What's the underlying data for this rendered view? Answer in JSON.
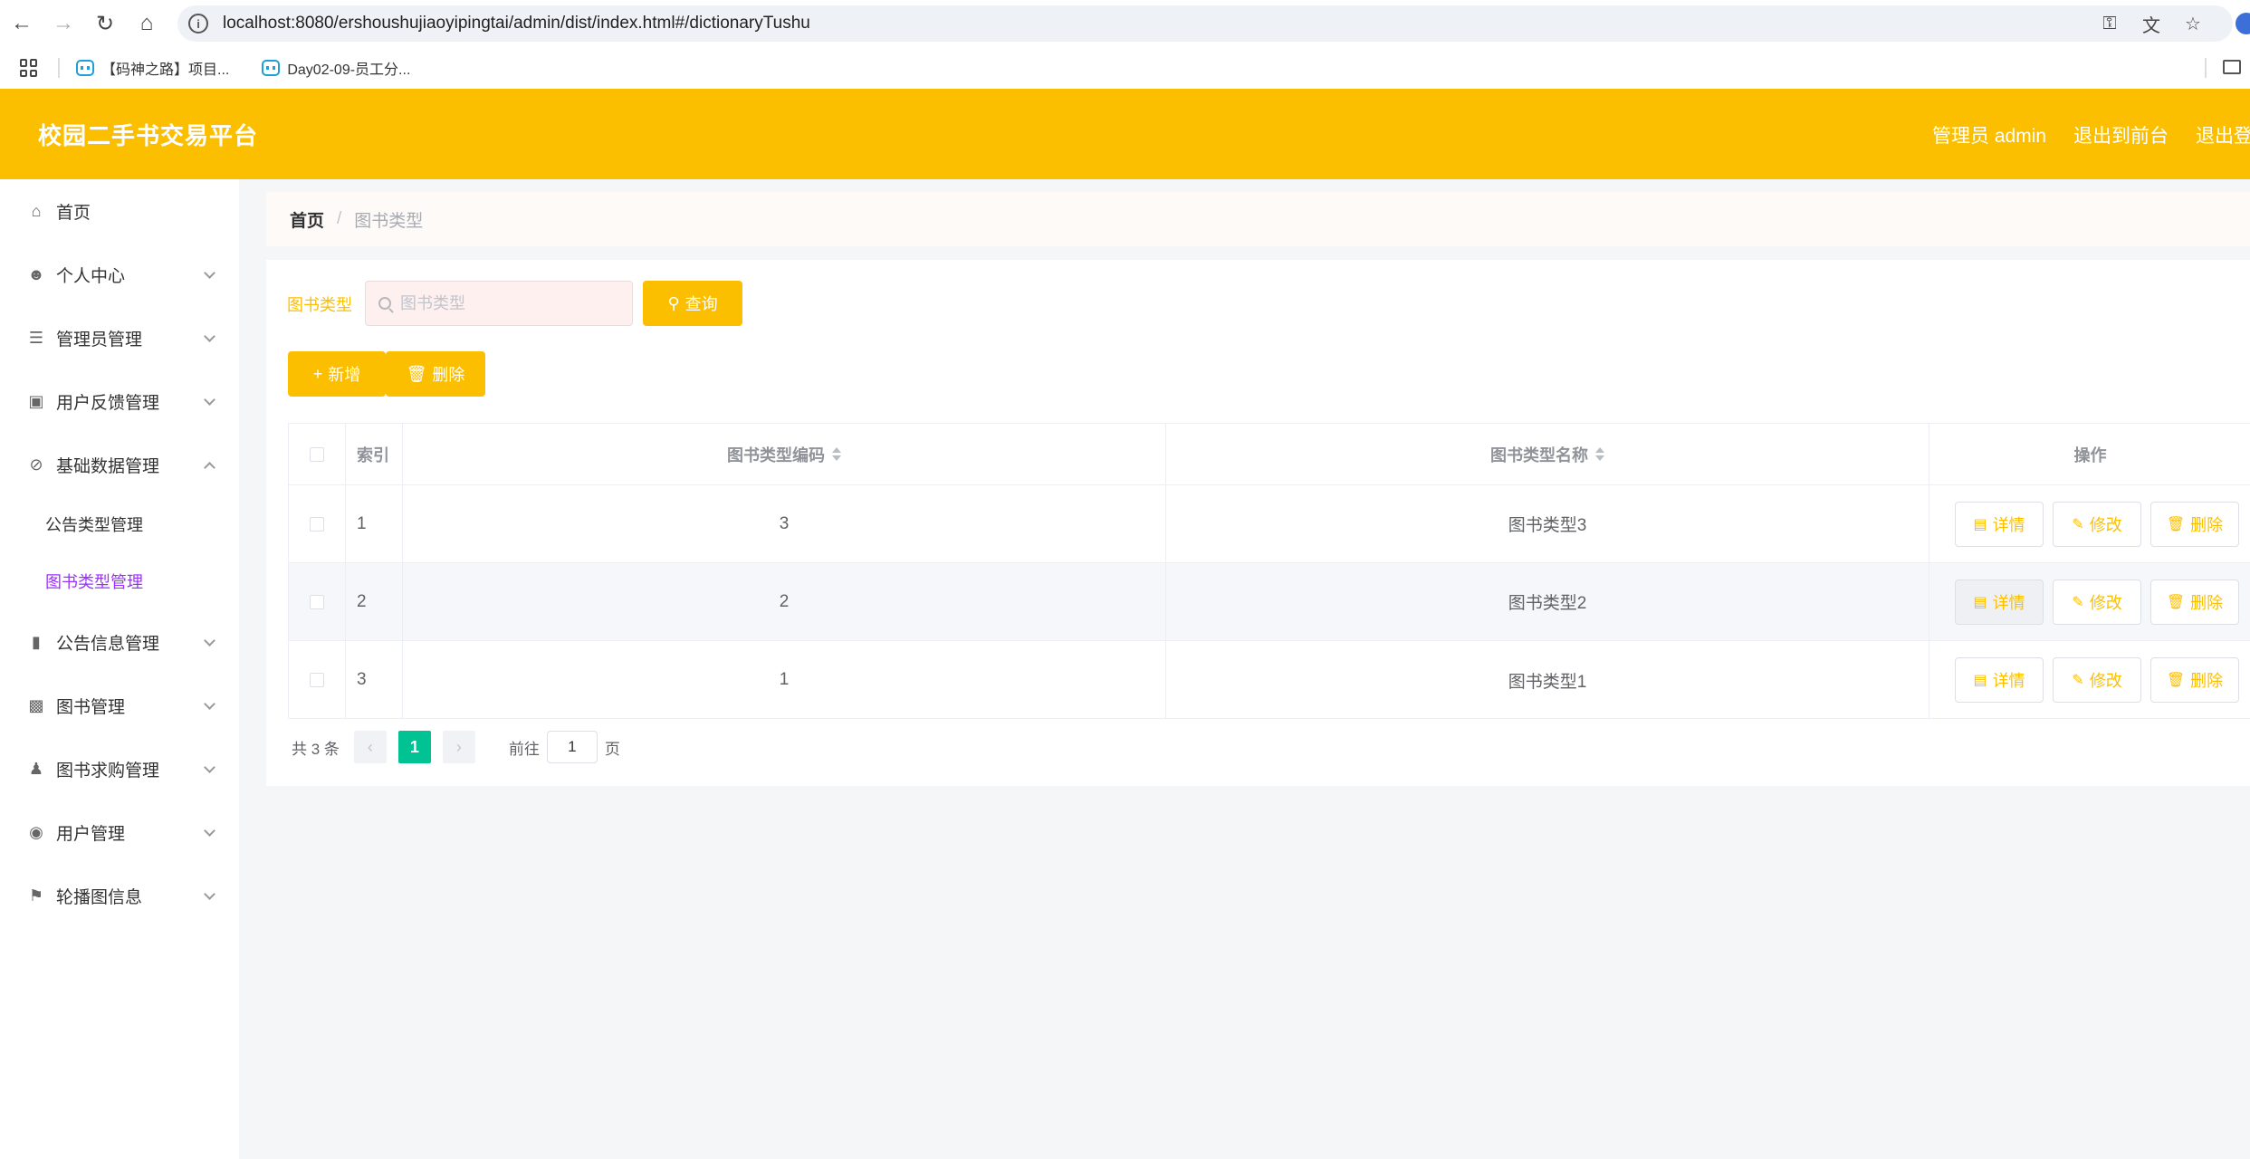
{
  "browser": {
    "url": "localhost:8080/ershoushujiaoyipingtai/admin/dist/index.html#/dictionaryTushu",
    "bookmarks": [
      "【码神之路】项目...",
      "Day02-09-员工分..."
    ]
  },
  "header": {
    "title": "校园二手书交易平台",
    "admin_label": "管理员 admin",
    "to_front_label": "退出到前台",
    "logout_label": "退出登录"
  },
  "sidebar": {
    "items": [
      {
        "label": "首页",
        "icon": "home-icon"
      },
      {
        "label": "个人中心",
        "icon": "user-icon"
      },
      {
        "label": "管理员管理",
        "icon": "sliders-icon"
      },
      {
        "label": "用户反馈管理",
        "icon": "clipboard-icon"
      },
      {
        "label": "基础数据管理",
        "icon": "bell-off-icon"
      },
      {
        "label": "公告信息管理",
        "icon": "ticket-icon"
      },
      {
        "label": "图书管理",
        "icon": "bar-chart-icon"
      },
      {
        "label": "图书求购管理",
        "icon": "stamp-icon"
      },
      {
        "label": "用户管理",
        "icon": "map-pin-icon"
      },
      {
        "label": "轮播图信息",
        "icon": "flag-icon"
      }
    ],
    "submenu": [
      {
        "label": "公告类型管理"
      },
      {
        "label": "图书类型管理"
      }
    ]
  },
  "breadcrumb": {
    "home": "首页",
    "separator": "/",
    "current": "图书类型"
  },
  "search": {
    "label": "图书类型",
    "placeholder": "图书类型",
    "query_label": "查询"
  },
  "actions": {
    "add_label": "新增",
    "delete_label": "删除"
  },
  "table": {
    "headers": [
      "索引",
      "图书类型编码",
      "图书类型名称",
      "操作"
    ],
    "rows": [
      {
        "index": "1",
        "code": "3",
        "name": "图书类型3"
      },
      {
        "index": "2",
        "code": "2",
        "name": "图书类型2"
      },
      {
        "index": "3",
        "code": "1",
        "name": "图书类型1"
      }
    ],
    "row_actions": {
      "detail": "详情",
      "edit": "修改",
      "delete": "删除"
    }
  },
  "pagination": {
    "total_text": "共 3 条",
    "current_page": "1",
    "goto_prefix": "前往",
    "goto_value": "1",
    "goto_suffix": "页"
  },
  "colors": {
    "brand": "#fcbf00",
    "active_submenu": "#9b30ff",
    "active_page": "#00c292"
  }
}
